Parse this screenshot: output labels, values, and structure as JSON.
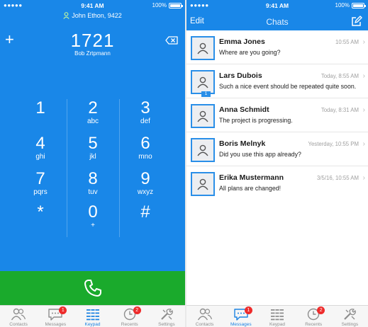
{
  "left": {
    "status": {
      "signal": "●●●●● ",
      "time": "9:41 AM",
      "battery": "100%"
    },
    "caller_line": "John Ethon, 9422",
    "dialed_number": "1721",
    "contact_name": "Bob Zrtpmann",
    "keys": [
      {
        "digit": "1",
        "letters": ""
      },
      {
        "digit": "2",
        "letters": "abc"
      },
      {
        "digit": "3",
        "letters": "def"
      },
      {
        "digit": "4",
        "letters": "ghi"
      },
      {
        "digit": "5",
        "letters": "jkl"
      },
      {
        "digit": "6",
        "letters": "mno"
      },
      {
        "digit": "7",
        "letters": "pqrs"
      },
      {
        "digit": "8",
        "letters": "tuv"
      },
      {
        "digit": "9",
        "letters": "wxyz"
      },
      {
        "digit": "*",
        "letters": ""
      },
      {
        "digit": "0",
        "letters": "+"
      },
      {
        "digit": "#",
        "letters": ""
      }
    ],
    "tabs": [
      {
        "label": "Contacts",
        "icon": "contacts-icon",
        "badge": ""
      },
      {
        "label": "Messages",
        "icon": "messages-icon",
        "badge": "1"
      },
      {
        "label": "Keypad",
        "icon": "keypad-icon",
        "badge": ""
      },
      {
        "label": "Recents",
        "icon": "recents-icon",
        "badge": "2"
      },
      {
        "label": "Settings",
        "icon": "settings-icon",
        "badge": ""
      }
    ],
    "active_tab": "Keypad"
  },
  "right": {
    "status": {
      "signal": "●●●●● ",
      "time": "9:41 AM",
      "battery": "100%"
    },
    "nav": {
      "edit": "Edit",
      "title": "Chats"
    },
    "chats": [
      {
        "name": "Emma Jones",
        "time": "10:55 AM",
        "message": "Where are you going?",
        "unread": ""
      },
      {
        "name": "Lars Dubois",
        "time": "Today, 8:55 AM",
        "message": "Such a nice event should be repeated quite soon.",
        "unread": "1"
      },
      {
        "name": "Anna Schmidt",
        "time": "Today, 8:31 AM",
        "message": "The project is progressing.",
        "unread": ""
      },
      {
        "name": "Boris Melnyk",
        "time": "Yesterday, 10:55 PM",
        "message": "Did you use this app already?",
        "unread": ""
      },
      {
        "name": "Erika Mustermann",
        "time": "3/5/16, 10:55 AM",
        "message": "All plans are changed!",
        "unread": ""
      }
    ],
    "tabs": [
      {
        "label": "Contacts",
        "icon": "contacts-icon",
        "badge": ""
      },
      {
        "label": "Messages",
        "icon": "messages-icon",
        "badge": "1"
      },
      {
        "label": "Keypad",
        "icon": "keypad-icon",
        "badge": ""
      },
      {
        "label": "Recents",
        "icon": "recents-icon",
        "badge": "2"
      },
      {
        "label": "Settings",
        "icon": "settings-icon",
        "badge": ""
      }
    ],
    "active_tab": "Messages"
  },
  "colors": {
    "brand_blue": "#1987e8",
    "call_green": "#1aaa2c",
    "badge_red": "#ee2b2b"
  }
}
